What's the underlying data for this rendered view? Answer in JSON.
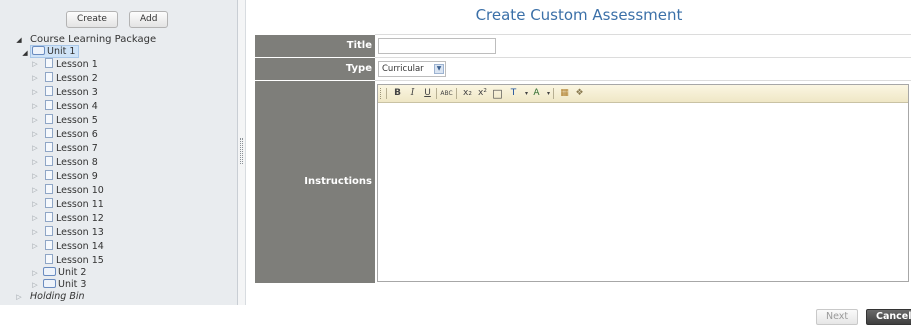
{
  "sidebar": {
    "create_label": "Create",
    "add_label": "Add",
    "tree": {
      "root": "Course Learning Package",
      "unit1": "Unit 1",
      "lessons": [
        "Lesson 1",
        "Lesson 2",
        "Lesson 3",
        "Lesson 4",
        "Lesson 5",
        "Lesson 6",
        "Lesson 7",
        "Lesson 8",
        "Lesson 9",
        "Lesson 10",
        "Lesson 11",
        "Lesson 12",
        "Lesson 13",
        "Lesson 14",
        "Lesson 15"
      ],
      "unit2": "Unit 2",
      "unit3": "Unit 3",
      "holding_bin": "Holding Bin"
    }
  },
  "main": {
    "page_title": "Create Custom Assessment",
    "form": {
      "title_label": "Title",
      "title_value": "",
      "type_label": "Type",
      "type_value": "Curricular",
      "instructions_label": "Instructions"
    },
    "toolbar": {
      "bold": "B",
      "italic": "I",
      "underline": "U",
      "spell": "ABC",
      "subscript": "x₂",
      "superscript": "x²",
      "table": "□",
      "text_color": "T",
      "highlight": "A",
      "paste": "▦",
      "image": "❖"
    }
  },
  "footer": {
    "next_label": "Next",
    "cancel_label": "Cancel"
  }
}
